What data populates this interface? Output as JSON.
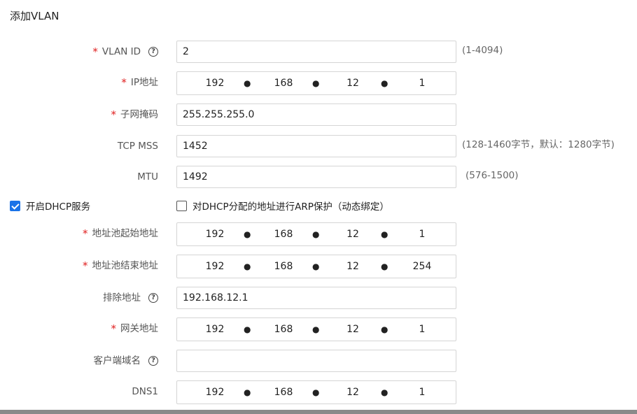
{
  "title": "添加VLAN",
  "vlan_id": {
    "label": "VLAN ID",
    "value": "2",
    "hint": "(1-4094)",
    "required": true
  },
  "ip": {
    "label": "IP地址",
    "octets": [
      "192",
      "168",
      "12",
      "1"
    ],
    "required": true
  },
  "subnet": {
    "label": "子网掩码",
    "value": "255.255.255.0",
    "required": true
  },
  "tcp_mss": {
    "label": "TCP MSS",
    "value": "1452",
    "hint": "(128-1460字节，默认：1280字节)"
  },
  "mtu": {
    "label": "MTU",
    "value": "1492",
    "hint": "(576-1500)"
  },
  "dhcp": {
    "label": "开启DHCP服务",
    "checked": true
  },
  "arp": {
    "label": "对DHCP分配的地址进行ARP保护（动态绑定）",
    "checked": false
  },
  "pool_start": {
    "label": "地址池起始地址",
    "octets": [
      "192",
      "168",
      "12",
      "1"
    ],
    "required": true
  },
  "pool_end": {
    "label": "地址池结束地址",
    "octets": [
      "192",
      "168",
      "12",
      "254"
    ],
    "required": true
  },
  "exclude": {
    "label": "排除地址",
    "value": "192.168.12.1"
  },
  "gateway": {
    "label": "网关地址",
    "octets": [
      "192",
      "168",
      "12",
      "1"
    ],
    "required": true
  },
  "domain": {
    "label": "客户端域名",
    "value": ""
  },
  "dns1": {
    "label": "DNS1",
    "octets": [
      "192",
      "168",
      "12",
      "1"
    ]
  },
  "colors": {
    "required": "#e02020",
    "checkbox_checked": "#1a73e8"
  },
  "icons": {
    "help": "question-circle-icon",
    "check": "check-icon"
  }
}
